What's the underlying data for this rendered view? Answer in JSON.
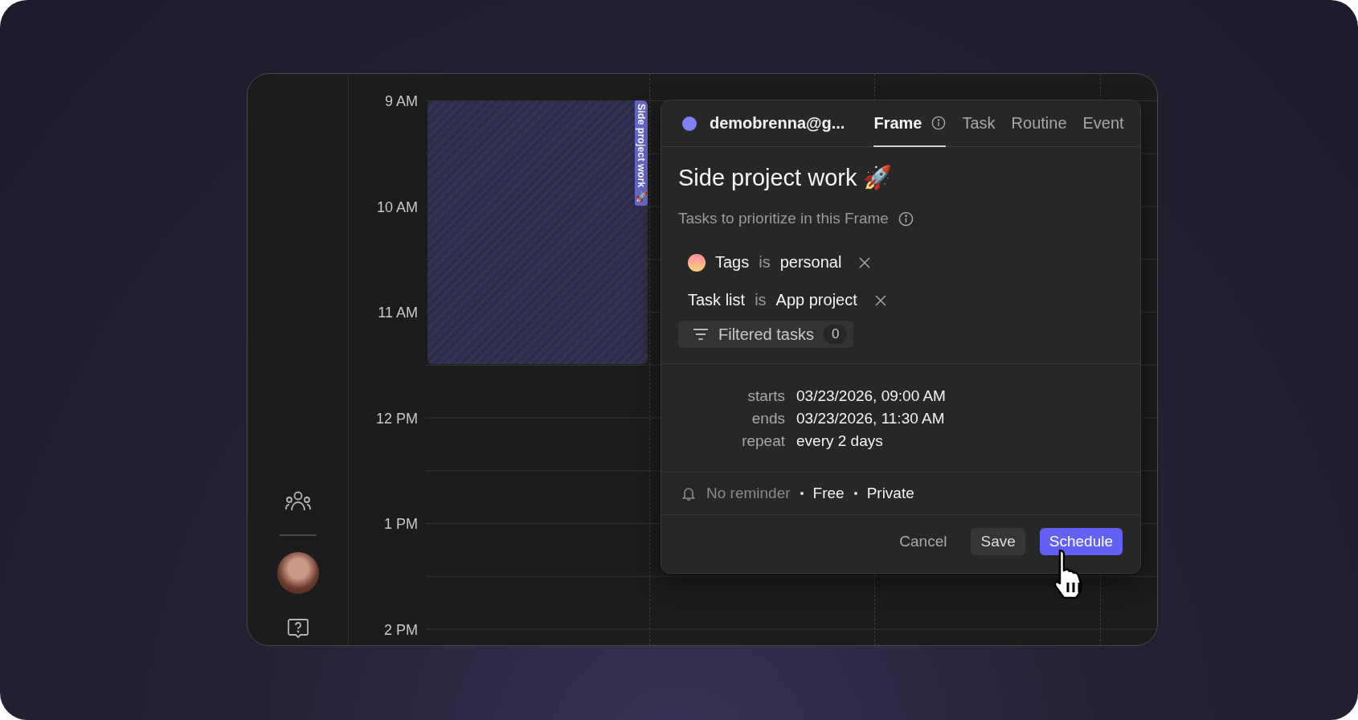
{
  "calendar": {
    "time_labels": [
      "9 AM",
      "10 AM",
      "11 AM",
      "12 PM",
      "1 PM",
      "2 PM"
    ],
    "event": {
      "label": "Side project work 🚀"
    }
  },
  "popup": {
    "account": "demobrenna@g...",
    "tabs": [
      {
        "label": "Frame",
        "selected": true,
        "info": true
      },
      {
        "label": "Task",
        "selected": false,
        "info": false
      },
      {
        "label": "Routine",
        "selected": false,
        "info": false
      },
      {
        "label": "Event",
        "selected": false,
        "info": false
      }
    ],
    "title": "Side project work 🚀",
    "subtitle": "Tasks to prioritize in this Frame",
    "filters": [
      {
        "kind": "tag",
        "field": "Tags",
        "operator": "is",
        "value": "personal"
      },
      {
        "kind": "list",
        "field": "Task list",
        "operator": "is",
        "value": "App project"
      }
    ],
    "filtered_tasks": {
      "label": "Filtered tasks",
      "count": "0"
    },
    "schedule": [
      {
        "label": "starts",
        "value": "03/23/2026, 09:00 AM"
      },
      {
        "label": "ends",
        "value": "03/23/2026, 11:30 AM"
      },
      {
        "label": "repeat",
        "value": "every 2 days"
      }
    ],
    "options": [
      {
        "label": "No reminder",
        "dimmed": true
      },
      {
        "label": "Free",
        "dimmed": false
      },
      {
        "label": "Private",
        "dimmed": false
      }
    ],
    "buttons": [
      {
        "kind": "text",
        "label": "Cancel"
      },
      {
        "kind": "secondary",
        "label": "Save"
      },
      {
        "kind": "primary",
        "label": "Schedule"
      }
    ]
  }
}
